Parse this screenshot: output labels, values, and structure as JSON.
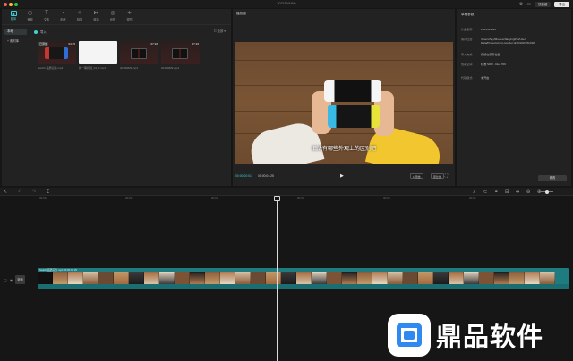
{
  "window": {
    "title": "202319/4/9/6",
    "buttons": [
      "快捷键",
      "导出"
    ]
  },
  "media_tabs": [
    {
      "label": "媒体",
      "icon": "media-icon",
      "glyph": "▣"
    },
    {
      "label": "音频",
      "icon": "audio-icon",
      "glyph": "◷"
    },
    {
      "label": "文本",
      "icon": "text-icon",
      "glyph": "T"
    },
    {
      "label": "贴纸",
      "icon": "sticker-icon",
      "glyph": "◔"
    },
    {
      "label": "特效",
      "icon": "effects-icon",
      "glyph": "✧"
    },
    {
      "label": "转场",
      "icon": "transition-icon",
      "glyph": "⋈"
    },
    {
      "label": "滤镜",
      "icon": "filter-icon",
      "glyph": "◎"
    },
    {
      "label": "调节",
      "icon": "adjust-icon",
      "glyph": "≑"
    }
  ],
  "side_nav": [
    "本地",
    "+ 素材库"
  ],
  "import": {
    "label": "导入"
  },
  "view": {
    "label": "☷ 全部 ▾"
  },
  "clips": [
    {
      "name": "Switch 画质渲染.mp4",
      "duration": "04:25",
      "badge": "已添加",
      "style": "dark",
      "mini": "switch"
    },
    {
      "name": "新一期视频_04_0.mp4",
      "duration": "",
      "badge": "",
      "style": "white",
      "mini": "none"
    },
    {
      "name": "20190829.mp4",
      "duration": "07:16",
      "badge": "",
      "style": "dark",
      "mini": "tv"
    },
    {
      "name": "20190829.mp4",
      "duration": "07:16",
      "badge": "",
      "style": "dark",
      "mini": "tv"
    }
  ],
  "player": {
    "title": "播放器",
    "subtitle": "旧版有哪些外观上的区别吧",
    "current_time": "00:00:00:01",
    "total_time": "00:00:04:25",
    "btn_original": "1:原始",
    "btn_ratio": "原比例"
  },
  "properties": {
    "title": "草稿参数",
    "rows": [
      {
        "k": "作品名称:",
        "v": "2023/3/4/9/6"
      },
      {
        "k": "保存位置:",
        "v": "/Users/hey/Movies/JianyingPro/User Data/Projects/com.lveditor.draft/2023/3/4/9/6"
      },
      {
        "k": "导入方式:",
        "v": "保留在原有位置"
      },
      {
        "k": "色彩空间:",
        "v": "标准 SDR - Rec.709"
      },
      {
        "k": "代理模式:",
        "v": "未开启"
      }
    ],
    "edit_label": "修改"
  },
  "toolbar": {
    "tools": [
      {
        "icon": "select-icon",
        "glyph": "↖",
        "dim": false
      },
      {
        "icon": "undo-icon",
        "glyph": "↶",
        "dim": true
      },
      {
        "icon": "redo-icon",
        "glyph": "↷",
        "dim": true
      },
      {
        "icon": "split-icon",
        "glyph": "⌶",
        "dim": false
      }
    ],
    "right_tools": [
      {
        "icon": "mic-icon",
        "glyph": "♪"
      },
      {
        "icon": "magnet-icon",
        "glyph": "⊂"
      },
      {
        "icon": "link-icon",
        "glyph": "⚭"
      },
      {
        "icon": "preview-icon",
        "glyph": "⊟"
      },
      {
        "icon": "center-icon",
        "glyph": "⇹"
      },
      {
        "icon": "zoom-out-icon",
        "glyph": "⊖"
      },
      {
        "icon": "zoom-in-icon",
        "glyph": "⊕"
      }
    ]
  },
  "ruler": [
    "00:00",
    "00:01",
    "00:02",
    "00:03",
    "00:04",
    "00:05"
  ],
  "track": {
    "label": "Switch 画质渲染.mp4   00:00:04:25",
    "cover_label": "封面",
    "frame_count": 34
  },
  "watermark": {
    "text": "鼎品软件"
  },
  "colors": {
    "accent": "#3fd3d6",
    "track": "#1e7c80",
    "background": "#161616"
  }
}
